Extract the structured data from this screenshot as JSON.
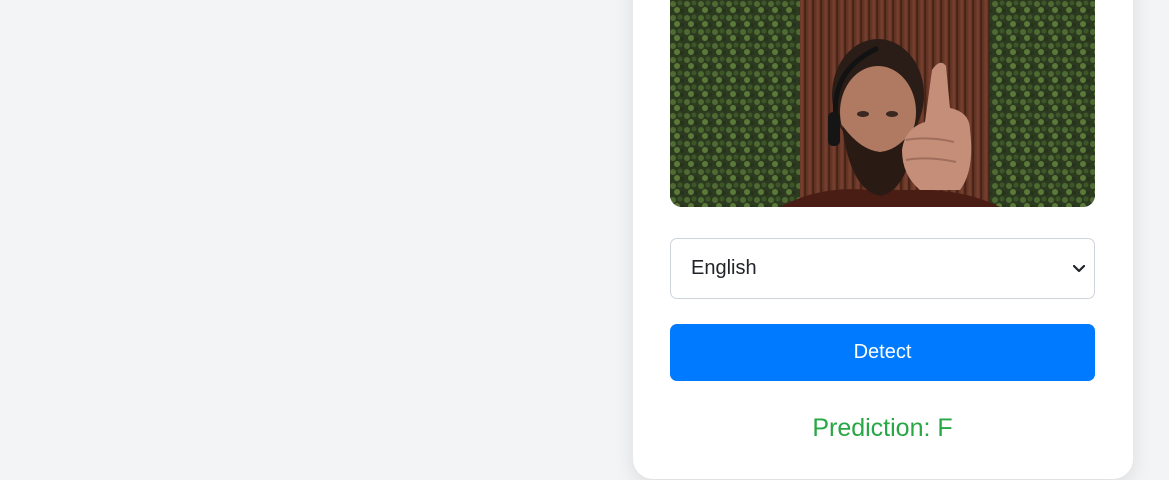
{
  "camera": {
    "alt": "webcam feed showing a person giving a thumbs-up"
  },
  "language_select": {
    "selected": "English",
    "icon": "chevron-down-icon"
  },
  "detect_button": {
    "label": "Detect",
    "color": "#007bff"
  },
  "prediction": {
    "label": "Prediction:",
    "value": "F",
    "color": "#28a745"
  }
}
